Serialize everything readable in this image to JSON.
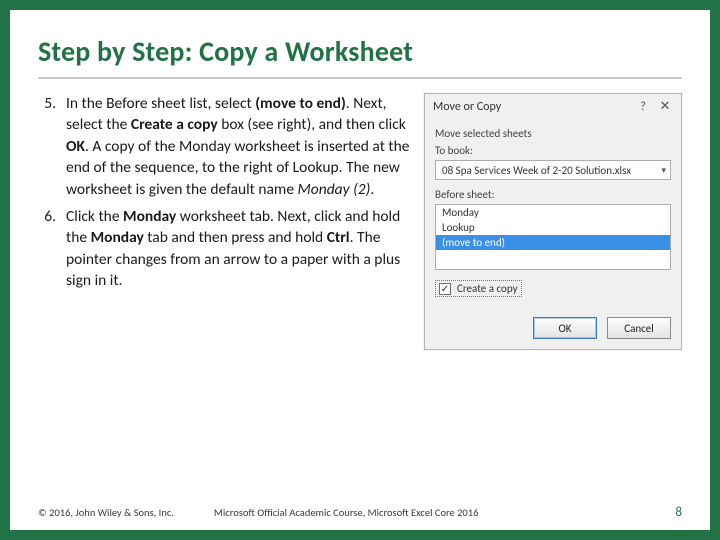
{
  "title": "Step by Step: Copy a Worksheet",
  "steps": {
    "s5": {
      "num": "5.",
      "p1a": "In the Before sheet list, select ",
      "p1b": "(move to end)",
      "p1c": ". Next, select the ",
      "p1d": "Create a copy",
      "p1e": " box (see right), and then click ",
      "p1f": "OK",
      "p1g": ". A copy of the Monday worksheet is inserted at the end of the sequence, to the right of Lookup. The new worksheet is given the default name ",
      "p1h": "Monday (2)",
      "p1i": "."
    },
    "s6": {
      "num": "6.",
      "p2a": "Click the ",
      "p2b": "Monday",
      "p2c": " worksheet tab. Next, click and hold the ",
      "p2d": "Monday",
      "p2e": " tab and then press and hold ",
      "p2f": "Ctrl",
      "p2g": ". The pointer changes from an arrow to a paper with a plus sign in it."
    }
  },
  "dialog": {
    "title": "Move or Copy",
    "move_label": "Move selected sheets",
    "to_book_label": "To book:",
    "to_book_value": "08 Spa Services Week of 2-20 Solution.xlsx",
    "before_sheet_label": "Before sheet:",
    "list": {
      "i0": "Monday",
      "i1": "Lookup",
      "i2": "(move to end)"
    },
    "create_copy_label": "Create a copy",
    "ok": "OK",
    "cancel": "Cancel",
    "help": "?",
    "close": "✕",
    "check": "✓"
  },
  "footer": {
    "copy": "© 2016, John Wiley & Sons, Inc.",
    "course": "Microsoft Official Academic Course, Microsoft Excel Core 2016",
    "page": "8"
  }
}
